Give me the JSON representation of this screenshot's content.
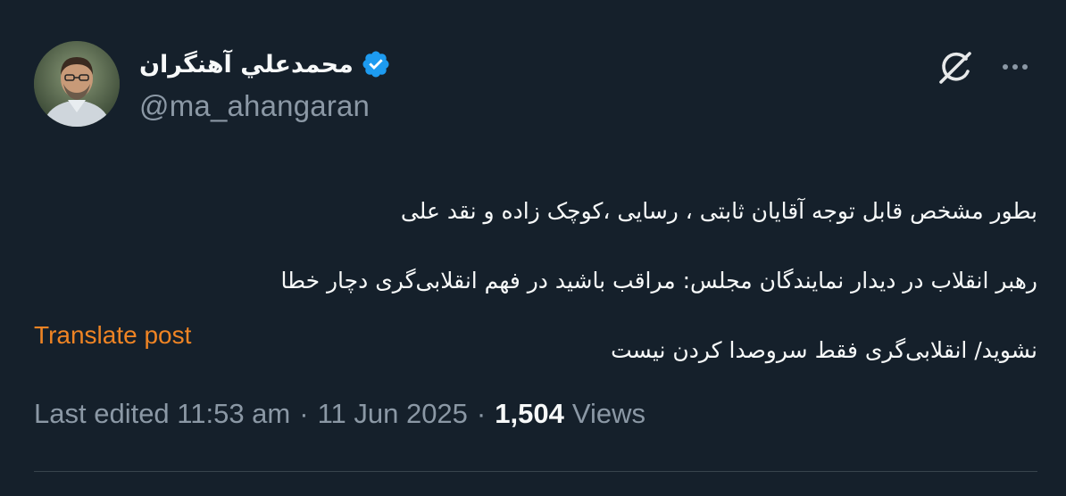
{
  "author": {
    "name": "محمدعلي آهنگران",
    "handle": "@ma_ahangaran",
    "verified": true,
    "verified_color": "#1d9bf0"
  },
  "post": {
    "lines": [
      "بطور مشخص قابل توجه آقایان ثابتی ، رسایی ،کوچک زاده و نقد علی",
      "رهبر انقلاب در دیدار نمایندگان مجلس: مراقب باشید در فهم انقلابی‌گری دچار خطا",
      "نشوید/ انقلابی‌گری فقط سروصدا کردن نیست"
    ],
    "translate_label": "Translate post"
  },
  "meta": {
    "edited": "Last edited 11:53 am",
    "separator": "·",
    "date": "11 Jun 2025",
    "views_count": "1,504",
    "views_label": "Views"
  },
  "icons": {
    "verified": "verified-badge-icon",
    "grok": "grok-icon",
    "more": "more-options-icon"
  },
  "colors": {
    "background": "#15202b",
    "text_primary": "#f7f9f9",
    "text_secondary": "#8b98a5",
    "translate_link": "#ef8424",
    "divider": "#38444d"
  }
}
